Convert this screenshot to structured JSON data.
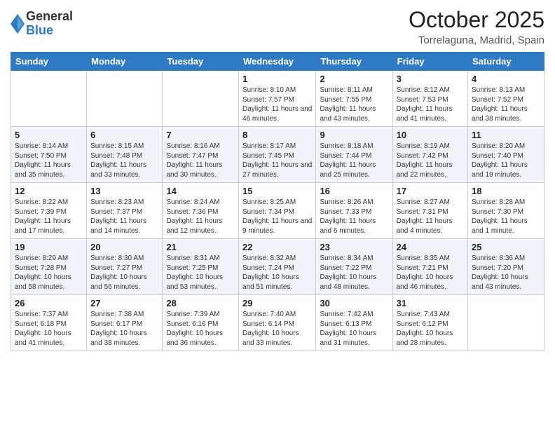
{
  "logo": {
    "general": "General",
    "blue": "Blue"
  },
  "header": {
    "month": "October 2025",
    "location": "Torrelaguna, Madrid, Spain"
  },
  "weekdays": [
    "Sunday",
    "Monday",
    "Tuesday",
    "Wednesday",
    "Thursday",
    "Friday",
    "Saturday"
  ],
  "weeks": [
    [
      {
        "day": "",
        "info": ""
      },
      {
        "day": "",
        "info": ""
      },
      {
        "day": "",
        "info": ""
      },
      {
        "day": "1",
        "info": "Sunrise: 8:10 AM\nSunset: 7:57 PM\nDaylight: 11 hours and 46 minutes."
      },
      {
        "day": "2",
        "info": "Sunrise: 8:11 AM\nSunset: 7:55 PM\nDaylight: 11 hours and 43 minutes."
      },
      {
        "day": "3",
        "info": "Sunrise: 8:12 AM\nSunset: 7:53 PM\nDaylight: 11 hours and 41 minutes."
      },
      {
        "day": "4",
        "info": "Sunrise: 8:13 AM\nSunset: 7:52 PM\nDaylight: 11 hours and 38 minutes."
      }
    ],
    [
      {
        "day": "5",
        "info": "Sunrise: 8:14 AM\nSunset: 7:50 PM\nDaylight: 11 hours and 35 minutes."
      },
      {
        "day": "6",
        "info": "Sunrise: 8:15 AM\nSunset: 7:48 PM\nDaylight: 11 hours and 33 minutes."
      },
      {
        "day": "7",
        "info": "Sunrise: 8:16 AM\nSunset: 7:47 PM\nDaylight: 11 hours and 30 minutes."
      },
      {
        "day": "8",
        "info": "Sunrise: 8:17 AM\nSunset: 7:45 PM\nDaylight: 11 hours and 27 minutes."
      },
      {
        "day": "9",
        "info": "Sunrise: 8:18 AM\nSunset: 7:44 PM\nDaylight: 11 hours and 25 minutes."
      },
      {
        "day": "10",
        "info": "Sunrise: 8:19 AM\nSunset: 7:42 PM\nDaylight: 11 hours and 22 minutes."
      },
      {
        "day": "11",
        "info": "Sunrise: 8:20 AM\nSunset: 7:40 PM\nDaylight: 11 hours and 19 minutes."
      }
    ],
    [
      {
        "day": "12",
        "info": "Sunrise: 8:22 AM\nSunset: 7:39 PM\nDaylight: 11 hours and 17 minutes."
      },
      {
        "day": "13",
        "info": "Sunrise: 8:23 AM\nSunset: 7:37 PM\nDaylight: 11 hours and 14 minutes."
      },
      {
        "day": "14",
        "info": "Sunrise: 8:24 AM\nSunset: 7:36 PM\nDaylight: 11 hours and 12 minutes."
      },
      {
        "day": "15",
        "info": "Sunrise: 8:25 AM\nSunset: 7:34 PM\nDaylight: 11 hours and 9 minutes."
      },
      {
        "day": "16",
        "info": "Sunrise: 8:26 AM\nSunset: 7:33 PM\nDaylight: 11 hours and 6 minutes."
      },
      {
        "day": "17",
        "info": "Sunrise: 8:27 AM\nSunset: 7:31 PM\nDaylight: 11 hours and 4 minutes."
      },
      {
        "day": "18",
        "info": "Sunrise: 8:28 AM\nSunset: 7:30 PM\nDaylight: 11 hours and 1 minute."
      }
    ],
    [
      {
        "day": "19",
        "info": "Sunrise: 8:29 AM\nSunset: 7:28 PM\nDaylight: 10 hours and 58 minutes."
      },
      {
        "day": "20",
        "info": "Sunrise: 8:30 AM\nSunset: 7:27 PM\nDaylight: 10 hours and 56 minutes."
      },
      {
        "day": "21",
        "info": "Sunrise: 8:31 AM\nSunset: 7:25 PM\nDaylight: 10 hours and 53 minutes."
      },
      {
        "day": "22",
        "info": "Sunrise: 8:32 AM\nSunset: 7:24 PM\nDaylight: 10 hours and 51 minutes."
      },
      {
        "day": "23",
        "info": "Sunrise: 8:34 AM\nSunset: 7:22 PM\nDaylight: 10 hours and 48 minutes."
      },
      {
        "day": "24",
        "info": "Sunrise: 8:35 AM\nSunset: 7:21 PM\nDaylight: 10 hours and 46 minutes."
      },
      {
        "day": "25",
        "info": "Sunrise: 8:36 AM\nSunset: 7:20 PM\nDaylight: 10 hours and 43 minutes."
      }
    ],
    [
      {
        "day": "26",
        "info": "Sunrise: 7:37 AM\nSunset: 6:18 PM\nDaylight: 10 hours and 41 minutes."
      },
      {
        "day": "27",
        "info": "Sunrise: 7:38 AM\nSunset: 6:17 PM\nDaylight: 10 hours and 38 minutes."
      },
      {
        "day": "28",
        "info": "Sunrise: 7:39 AM\nSunset: 6:16 PM\nDaylight: 10 hours and 36 minutes."
      },
      {
        "day": "29",
        "info": "Sunrise: 7:40 AM\nSunset: 6:14 PM\nDaylight: 10 hours and 33 minutes."
      },
      {
        "day": "30",
        "info": "Sunrise: 7:42 AM\nSunset: 6:13 PM\nDaylight: 10 hours and 31 minutes."
      },
      {
        "day": "31",
        "info": "Sunrise: 7:43 AM\nSunset: 6:12 PM\nDaylight: 10 hours and 28 minutes."
      },
      {
        "day": "",
        "info": ""
      }
    ]
  ]
}
